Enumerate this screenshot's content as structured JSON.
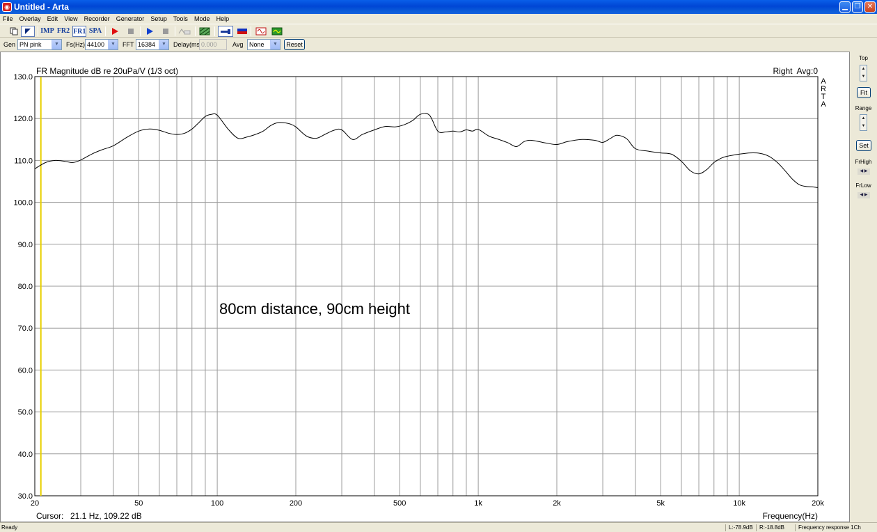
{
  "window": {
    "title": "Untitled - Arta",
    "app_icon": "arta-icon"
  },
  "menu": [
    "File",
    "Overlay",
    "Edit",
    "View",
    "Recorder",
    "Generator",
    "Setup",
    "Tools",
    "Mode",
    "Help"
  ],
  "toolbar": {
    "imp_label": "IMP",
    "fr2_label": "FR2",
    "fr1_label": "FR1",
    "spa_label": "SPA"
  },
  "genrow": {
    "gen_label": "Gen",
    "gen_value": "PN pink",
    "fs_label": "Fs(Hz)",
    "fs_value": "44100",
    "fft_label": "FFT",
    "fft_value": "16384",
    "delay_label": "Delay(ms)",
    "delay_value": "0.000",
    "avg_label": "Avg",
    "avg_value": "None",
    "reset_label": "Reset"
  },
  "right_panel": {
    "top_label": "Top",
    "fit_label": "Fit",
    "range_label": "Range",
    "set_label": "Set",
    "frhigh_label": "FrHigh",
    "frlow_label": "FrLow"
  },
  "status": {
    "ready": "Ready",
    "left_level": "L:-78.9dB",
    "right_level": "R:-18.8dB",
    "mode": "Frequency response 1Ch"
  },
  "chart_data": {
    "type": "line",
    "title": "FR Magnitude dB re 20uPa/V (1/3 oct)",
    "right_label": "Right  Avg:0",
    "brand": "ARTA",
    "annotation": "80cm distance, 90cm height",
    "xlabel": "Frequency(Hz)",
    "xscale": "log",
    "xlim": [
      20,
      20000
    ],
    "ylim": [
      30,
      130
    ],
    "y_ticks": [
      "30.0",
      "40.0",
      "50.0",
      "60.0",
      "70.0",
      "80.0",
      "90.0",
      "100.0",
      "110.0",
      "120.0",
      "130.0"
    ],
    "y_tick_values": [
      30,
      40,
      50,
      60,
      70,
      80,
      90,
      100,
      110,
      120,
      130
    ],
    "x_tick_labels": [
      "20",
      "50",
      "100",
      "200",
      "500",
      "1k",
      "2k",
      "5k",
      "10k",
      "20k"
    ],
    "x_tick_values": [
      20,
      50,
      100,
      200,
      500,
      1000,
      2000,
      5000,
      10000,
      20000
    ],
    "grid": true,
    "cursor": {
      "label": "Cursor:",
      "value_text": "21.1 Hz, 109.22 dB",
      "x": 21.1,
      "y": 109.22
    },
    "series": [
      {
        "color": "#000000",
        "x": [
          20,
          22,
          24,
          26,
          28,
          30,
          33,
          36,
          40,
          45,
          50,
          55,
          60,
          65,
          70,
          75,
          80,
          85,
          90,
          95,
          100,
          110,
          120,
          130,
          140,
          150,
          160,
          170,
          180,
          190,
          200,
          220,
          240,
          260,
          280,
          300,
          330,
          360,
          400,
          440,
          480,
          520,
          560,
          600,
          650,
          700,
          750,
          800,
          850,
          900,
          950,
          1000,
          1100,
          1200,
          1300,
          1400,
          1500,
          1600,
          1800,
          2000,
          2200,
          2500,
          2800,
          3000,
          3200,
          3400,
          3700,
          4000,
          4500,
          5000,
          5500,
          6000,
          6500,
          7000,
          7500,
          8000,
          8500,
          9000,
          10000,
          11000,
          12000,
          13000,
          14000,
          15000,
          16000,
          17000,
          18000,
          19000,
          20000
        ],
        "y": [
          108,
          109.5,
          110,
          109.8,
          109.5,
          110.1,
          111.5,
          112.5,
          113.5,
          115.5,
          117,
          117.5,
          117.2,
          116.5,
          116.2,
          116.5,
          117.5,
          119,
          120.5,
          121,
          120.8,
          117.5,
          115.3,
          115.6,
          116.2,
          117,
          118.3,
          119,
          119,
          118.7,
          118,
          115.8,
          115.3,
          116.3,
          117.2,
          117.3,
          115,
          116.2,
          117.3,
          118.1,
          118,
          118.5,
          119.5,
          121,
          120.8,
          117,
          116.8,
          117,
          116.8,
          117.3,
          117,
          117.4,
          115.8,
          115,
          114.2,
          113.3,
          114.5,
          114.8,
          114.2,
          113.8,
          114.5,
          115,
          114.8,
          114.3,
          115.2,
          116,
          115.2,
          112.8,
          112.2,
          111.8,
          111.5,
          109.8,
          107.5,
          106.8,
          107.8,
          109.5,
          110.5,
          111,
          111.5,
          111.8,
          111.7,
          111,
          109.5,
          107.5,
          105.5,
          104.2,
          103.8,
          103.7,
          103.5
        ]
      }
    ]
  }
}
